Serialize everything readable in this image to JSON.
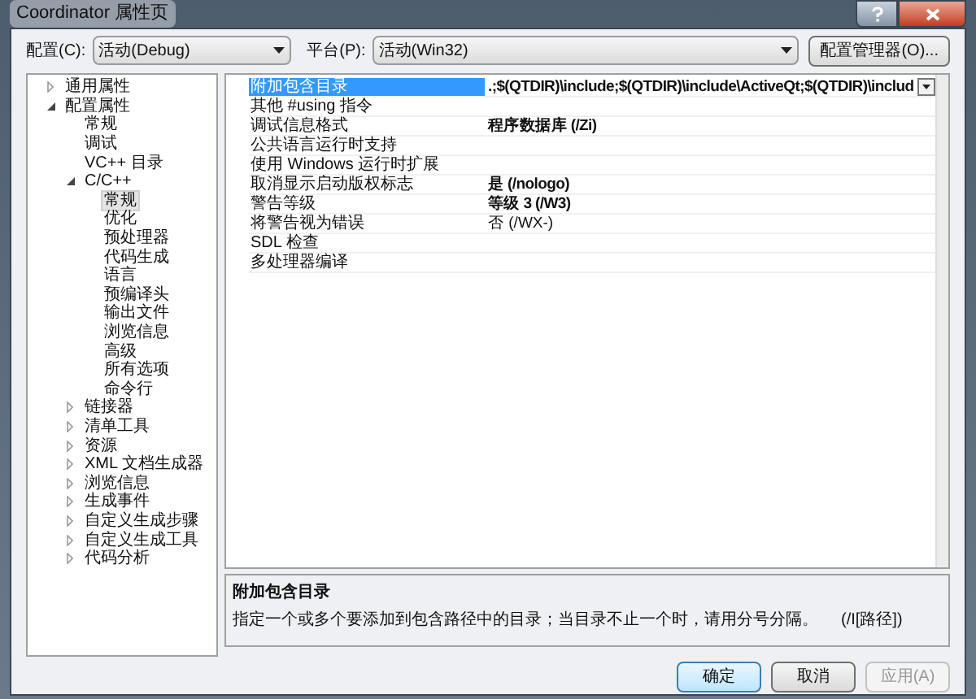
{
  "window": {
    "title": "Coordinator 属性页"
  },
  "toolbar": {
    "config_label": "配置(C):",
    "config_value": "活动(Debug)",
    "platform_label": "平台(P):",
    "platform_value": "活动(Win32)",
    "manager_button": "配置管理器(O)..."
  },
  "tree": [
    {
      "label": "通用属性",
      "expanded": false,
      "selected": false
    },
    {
      "label": "配置属性",
      "expanded": true,
      "selected": false,
      "children": [
        {
          "label": "常规",
          "selected": false
        },
        {
          "label": "调试",
          "selected": false
        },
        {
          "label": "VC++ 目录",
          "selected": false
        },
        {
          "label": "C/C++",
          "expanded": true,
          "selected": false,
          "children": [
            {
              "label": "常规",
              "selected": true
            },
            {
              "label": "优化",
              "selected": false
            },
            {
              "label": "预处理器",
              "selected": false
            },
            {
              "label": "代码生成",
              "selected": false
            },
            {
              "label": "语言",
              "selected": false
            },
            {
              "label": "预编译头",
              "selected": false
            },
            {
              "label": "输出文件",
              "selected": false
            },
            {
              "label": "浏览信息",
              "selected": false
            },
            {
              "label": "高级",
              "selected": false
            },
            {
              "label": "所有选项",
              "selected": false
            },
            {
              "label": "命令行",
              "selected": false
            }
          ]
        },
        {
          "label": "链接器",
          "expanded": false,
          "selected": false
        },
        {
          "label": "清单工具",
          "expanded": false,
          "selected": false
        },
        {
          "label": "资源",
          "expanded": false,
          "selected": false
        },
        {
          "label": "XML 文档生成器",
          "expanded": false,
          "selected": false
        },
        {
          "label": "浏览信息",
          "expanded": false,
          "selected": false
        },
        {
          "label": "生成事件",
          "expanded": false,
          "selected": false
        },
        {
          "label": "自定义生成步骤",
          "expanded": false,
          "selected": false
        },
        {
          "label": "自定义生成工具",
          "expanded": false,
          "selected": false
        },
        {
          "label": "代码分析",
          "expanded": false,
          "selected": false
        }
      ]
    }
  ],
  "properties": [
    {
      "name": "附加包含目录",
      "value": ".;$(QTDIR)\\include;$(QTDIR)\\include\\ActiveQt;$(QTDIR)\\includ",
      "bold": true,
      "selected": true
    },
    {
      "name": "其他 #using 指令",
      "selected": false
    },
    {
      "name": "调试信息格式",
      "value": "程序数据库 (/Zi)",
      "bold": true,
      "selected": false
    },
    {
      "name": "公共语言运行时支持",
      "selected": false
    },
    {
      "name": "使用 Windows 运行时扩展",
      "selected": false
    },
    {
      "name": "取消显示启动版权标志",
      "value": "是 (/nologo)",
      "bold": true,
      "selected": false
    },
    {
      "name": "警告等级",
      "value": "等级 3 (/W3)",
      "bold": true,
      "selected": false
    },
    {
      "name": "将警告视为错误",
      "value": "否 (/WX-)",
      "bold": false,
      "selected": false
    },
    {
      "name": "SDL 检查",
      "selected": false
    },
    {
      "name": "多处理器编译",
      "selected": false
    }
  ],
  "description": {
    "title": "附加包含目录",
    "text": "指定一个或多个要添加到包含路径中的目录；当目录不止一个时，请用分号分隔。",
    "switch": "(/I[路径])"
  },
  "buttons": [
    {
      "label": "确定",
      "disabled": false,
      "default": true
    },
    {
      "label": "取消",
      "disabled": false,
      "default": false
    },
    {
      "label": "应用(A)",
      "disabled": true,
      "default": false
    }
  ]
}
